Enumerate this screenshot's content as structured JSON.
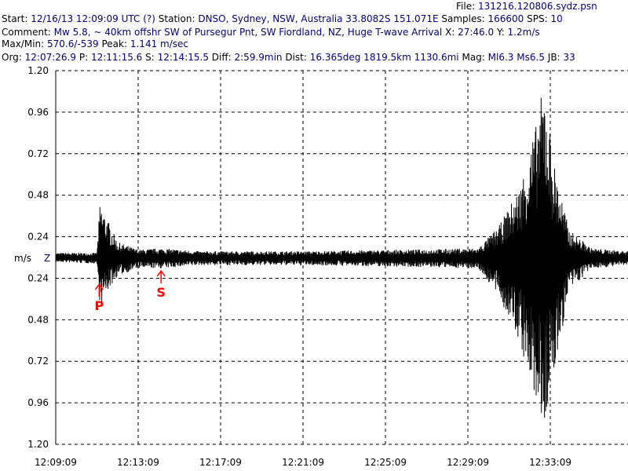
{
  "header": {
    "file_label": "File:",
    "file_value": "131216.120806.sydz.psn",
    "start_label": "Start:",
    "start_value": "12/16/13 12:09:09 UTC (?)",
    "station_label": "Station:",
    "station_value": "DNSO, Sydney, NSW, Australia 33.8082S 151.071E",
    "samples_label": "Samples:",
    "samples_value": "166600",
    "sps_label": "SPS:",
    "sps_value": "10",
    "comment_label": "Comment:",
    "comment_value": "Mw 5.8, ~ 40km offshr SW of Pursegur Pnt, SW Fiordland, NZ, Huge T-wave Arrival",
    "x_label": "X:",
    "x_value": "27:46.0",
    "y_label": "Y:",
    "y_value": "1.2m/s",
    "maxmin_label": "Max/Min:",
    "maxmin_value": "570.6/-539",
    "peak_label": "Peak:",
    "peak_value": "1.141 m/sec",
    "org_label": "Org:",
    "org_value": "12:07:26.9",
    "p_label": "P:",
    "p_value": "12:11:15.6",
    "s_label": "S:",
    "s_value": "12:14:15.5",
    "diff_label": "Diff:",
    "diff_value": "2:59.9min",
    "dist_label": "Dist:",
    "dist_value": "16.365deg 1819.5km 1130.6mi",
    "mag_label": "Mag:",
    "mag_value": "Ml6.3 Ms6.5",
    "jb_label": "JB:",
    "jb_value": "33"
  },
  "chart_data": {
    "type": "line",
    "ylabel": "m/s",
    "channel": "Z",
    "y_tick_labels": [
      "1.20",
      "0.96",
      "0.72",
      "0.48",
      "0.24",
      "0.24",
      "0.48",
      "0.72",
      "0.96",
      "1.20"
    ],
    "ylim": [
      -1.2,
      1.2
    ],
    "x_tick_labels": [
      "12:09:09",
      "12:13:09",
      "12:17:09",
      "12:21:09",
      "12:25:09",
      "12:29:09",
      "12:33:09"
    ],
    "x_range_minutes": [
      0,
      27.77
    ],
    "grid": true,
    "markers": [
      {
        "label": "P",
        "time": "12:11:15.6",
        "minutes": 2.11
      },
      {
        "label": "S",
        "time": "12:14:15.5",
        "minutes": 5.11
      }
    ],
    "envelope": [
      {
        "t": 0.0,
        "max": 0.03,
        "min": -0.03
      },
      {
        "t": 2.0,
        "max": 0.03,
        "min": -0.04
      },
      {
        "t": 2.15,
        "max": 0.35,
        "min": -0.33
      },
      {
        "t": 2.5,
        "max": 0.25,
        "min": -0.22
      },
      {
        "t": 3.0,
        "max": 0.1,
        "min": -0.12
      },
      {
        "t": 4.0,
        "max": 0.05,
        "min": -0.07
      },
      {
        "t": 5.11,
        "max": 0.06,
        "min": -0.07
      },
      {
        "t": 7.0,
        "max": 0.04,
        "min": -0.05
      },
      {
        "t": 12.0,
        "max": 0.04,
        "min": -0.05
      },
      {
        "t": 17.0,
        "max": 0.05,
        "min": -0.06
      },
      {
        "t": 20.5,
        "max": 0.06,
        "min": -0.07
      },
      {
        "t": 21.5,
        "max": 0.2,
        "min": -0.25
      },
      {
        "t": 22.5,
        "max": 0.45,
        "min": -0.55
      },
      {
        "t": 23.3,
        "max": 0.85,
        "min": -0.95
      },
      {
        "t": 23.7,
        "max": 1.14,
        "min": -1.1
      },
      {
        "t": 24.2,
        "max": 0.6,
        "min": -0.75
      },
      {
        "t": 24.9,
        "max": 0.18,
        "min": -0.22
      },
      {
        "t": 26.0,
        "max": 0.06,
        "min": -0.07
      },
      {
        "t": 27.77,
        "max": 0.04,
        "min": -0.05
      }
    ]
  }
}
